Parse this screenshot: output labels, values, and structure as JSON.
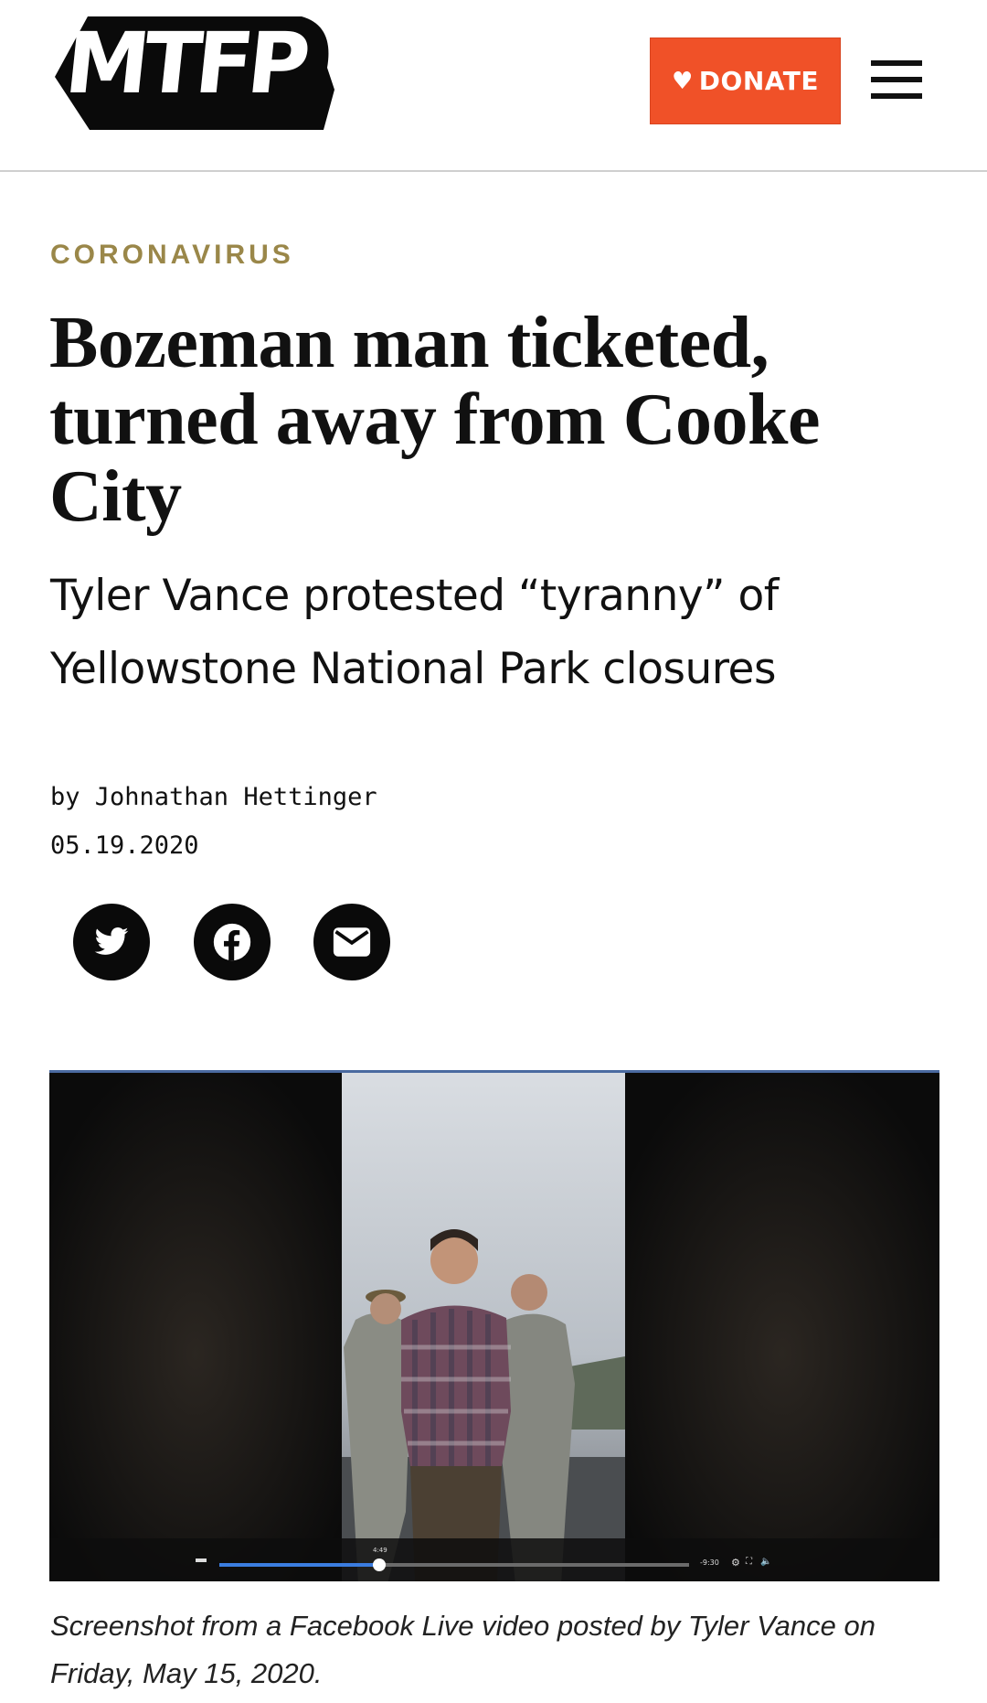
{
  "header": {
    "logo_text": "MTFP",
    "donate_label": "DONATE",
    "menu_icon": "hamburger-menu-icon"
  },
  "article": {
    "category": "CORONAVIRUS",
    "headline": "Bozeman man ticketed, turned away from Cooke City",
    "subhead": "Tyler Vance protested “tyranny” of Yellowstone National Park closures",
    "byline": "by Johnathan Hettinger",
    "date": "05.19.2020"
  },
  "share": {
    "icons": [
      "twitter-icon",
      "facebook-icon",
      "email-icon"
    ]
  },
  "photo": {
    "description_icon": "video-screenshot",
    "player": {
      "progress": 0.34,
      "current_time": "4:49",
      "remaining_time": "-9:30"
    },
    "caption": "Screenshot from a Facebook Live video posted by Tyler Vance on Friday, May 15, 2020."
  },
  "colors": {
    "donate_bg": "#f05128",
    "category": "#9a8749",
    "text": "#111111",
    "player_progress": "#3b7de0"
  }
}
